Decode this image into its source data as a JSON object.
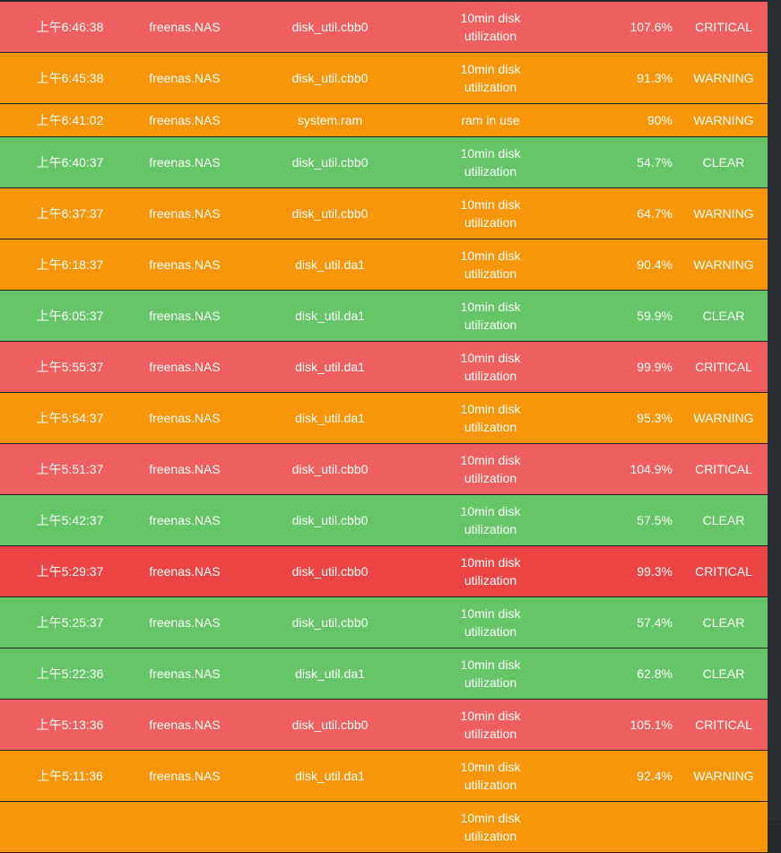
{
  "alerts": [
    {
      "time": "上午6:46:38",
      "host": "freenas.NAS",
      "source": "disk_util.cbb0",
      "desc": "10min disk utilization",
      "value": "107.6%",
      "level": "CRITICAL",
      "style": "critical"
    },
    {
      "time": "上午6:45:38",
      "host": "freenas.NAS",
      "source": "disk_util.cbb0",
      "desc": "10min disk utilization",
      "value": "91.3%",
      "level": "WARNING",
      "style": "warning"
    },
    {
      "time": "上午6:41:02",
      "host": "freenas.NAS",
      "source": "system.ram",
      "desc": "ram in use",
      "value": "90%",
      "level": "WARNING",
      "style": "warning short"
    },
    {
      "time": "上午6:40:37",
      "host": "freenas.NAS",
      "source": "disk_util.cbb0",
      "desc": "10min disk utilization",
      "value": "54.7%",
      "level": "CLEAR",
      "style": "clear"
    },
    {
      "time": "上午6:37:37",
      "host": "freenas.NAS",
      "source": "disk_util.cbb0",
      "desc": "10min disk utilization",
      "value": "64.7%",
      "level": "WARNING",
      "style": "warning"
    },
    {
      "time": "上午6:18:37",
      "host": "freenas.NAS",
      "source": "disk_util.da1",
      "desc": "10min disk utilization",
      "value": "90.4%",
      "level": "WARNING",
      "style": "warning"
    },
    {
      "time": "上午6:05:37",
      "host": "freenas.NAS",
      "source": "disk_util.da1",
      "desc": "10min disk utilization",
      "value": "59.9%",
      "level": "CLEAR",
      "style": "clear"
    },
    {
      "time": "上午5:55:37",
      "host": "freenas.NAS",
      "source": "disk_util.da1",
      "desc": "10min disk utilization",
      "value": "99.9%",
      "level": "CRITICAL",
      "style": "critical"
    },
    {
      "time": "上午5:54:37",
      "host": "freenas.NAS",
      "source": "disk_util.da1",
      "desc": "10min disk utilization",
      "value": "95.3%",
      "level": "WARNING",
      "style": "warning"
    },
    {
      "time": "上午5:51:37",
      "host": "freenas.NAS",
      "source": "disk_util.cbb0",
      "desc": "10min disk utilization",
      "value": "104.9%",
      "level": "CRITICAL",
      "style": "critical"
    },
    {
      "time": "上午5:42:37",
      "host": "freenas.NAS",
      "source": "disk_util.cbb0",
      "desc": "10min disk utilization",
      "value": "57.5%",
      "level": "CLEAR",
      "style": "clear"
    },
    {
      "time": "上午5:29:37",
      "host": "freenas.NAS",
      "source": "disk_util.cbb0",
      "desc": "10min disk utilization",
      "value": "99.3%",
      "level": "CRITICAL",
      "style": "critical-alt"
    },
    {
      "time": "上午5:25:37",
      "host": "freenas.NAS",
      "source": "disk_util.cbb0",
      "desc": "10min disk utilization",
      "value": "57.4%",
      "level": "CLEAR",
      "style": "clear"
    },
    {
      "time": "上午5:22:36",
      "host": "freenas.NAS",
      "source": "disk_util.da1",
      "desc": "10min disk utilization",
      "value": "62.8%",
      "level": "CLEAR",
      "style": "clear"
    },
    {
      "time": "上午5:13:36",
      "host": "freenas.NAS",
      "source": "disk_util.cbb0",
      "desc": "10min disk utilization",
      "value": "105.1%",
      "level": "CRITICAL",
      "style": "critical"
    },
    {
      "time": "上午5:11:36",
      "host": "freenas.NAS",
      "source": "disk_util.da1",
      "desc": "10min disk utilization",
      "value": "92.4%",
      "level": "WARNING",
      "style": "warning"
    },
    {
      "time": "",
      "host": "",
      "source": "",
      "desc": "10min disk utilization",
      "value": "",
      "level": "",
      "style": "warning"
    }
  ],
  "colors": {
    "critical": "#ef5f5f",
    "critical_alt": "#ea4444",
    "warning": "#f7960a",
    "clear": "#64c466",
    "background": "#262a2e"
  }
}
